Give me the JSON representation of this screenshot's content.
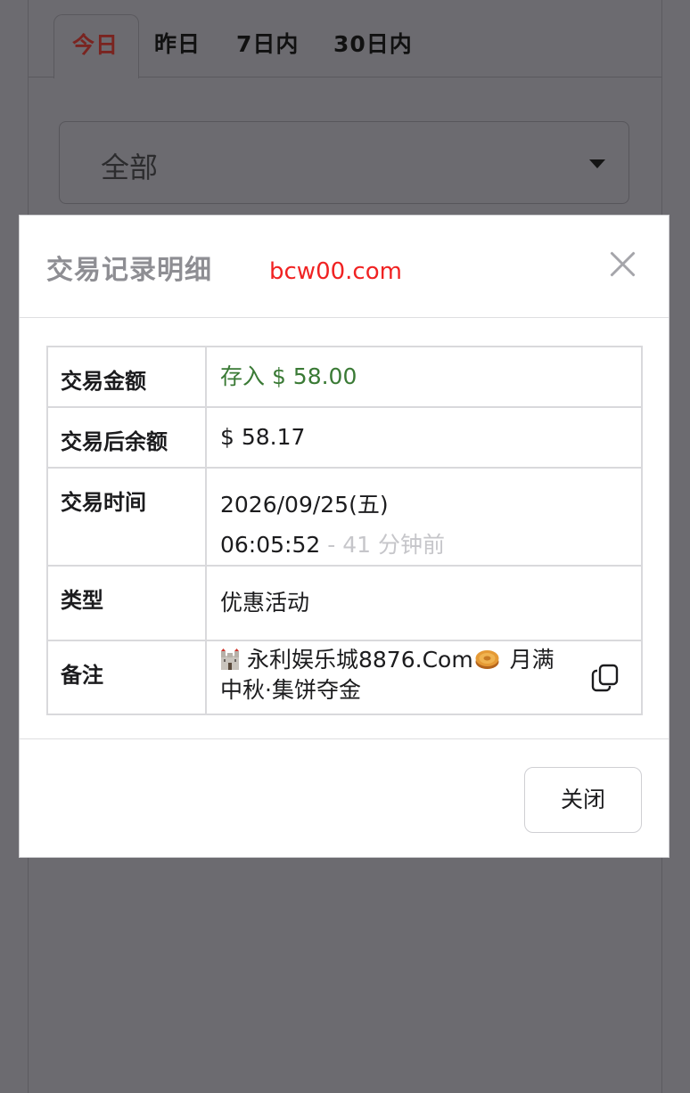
{
  "tabs": [
    {
      "label": "今日",
      "active": true
    },
    {
      "label": "昨日",
      "active": false
    },
    {
      "label": "7日内",
      "active": false
    },
    {
      "label": "30日内",
      "active": false
    }
  ],
  "filter": {
    "selected": "全部"
  },
  "modal": {
    "title": "交易记录明细",
    "watermark": "bcw00.com",
    "rows": {
      "amount": {
        "label": "交易金额",
        "value": "存入 $ 58.00"
      },
      "balance": {
        "label": "交易后余额",
        "value": "$ 58.17"
      },
      "time": {
        "label": "交易时间",
        "date": "2026/09/25(五)",
        "clock": "06:05:52",
        "relative": " - 41 分钟前"
      },
      "type": {
        "label": "类型",
        "value": "优惠活动"
      },
      "note": {
        "label": "备注",
        "value_part1": "永利娱乐城8876.Com",
        "value_part2": " 月满中秋·集饼夺金"
      }
    },
    "close_label": "关闭"
  },
  "colors": {
    "deposit_green": "#3a7a35",
    "active_tab_red": "#7a2420",
    "watermark_red": "#f02222",
    "overlay": "#6c6b70"
  },
  "icons": {
    "close": "close-icon",
    "copy": "copy-icon",
    "dropdown": "chevron-down-icon",
    "castle_emoji": "castle-emoji-icon",
    "mooncake_emoji": "mooncake-emoji-icon"
  }
}
